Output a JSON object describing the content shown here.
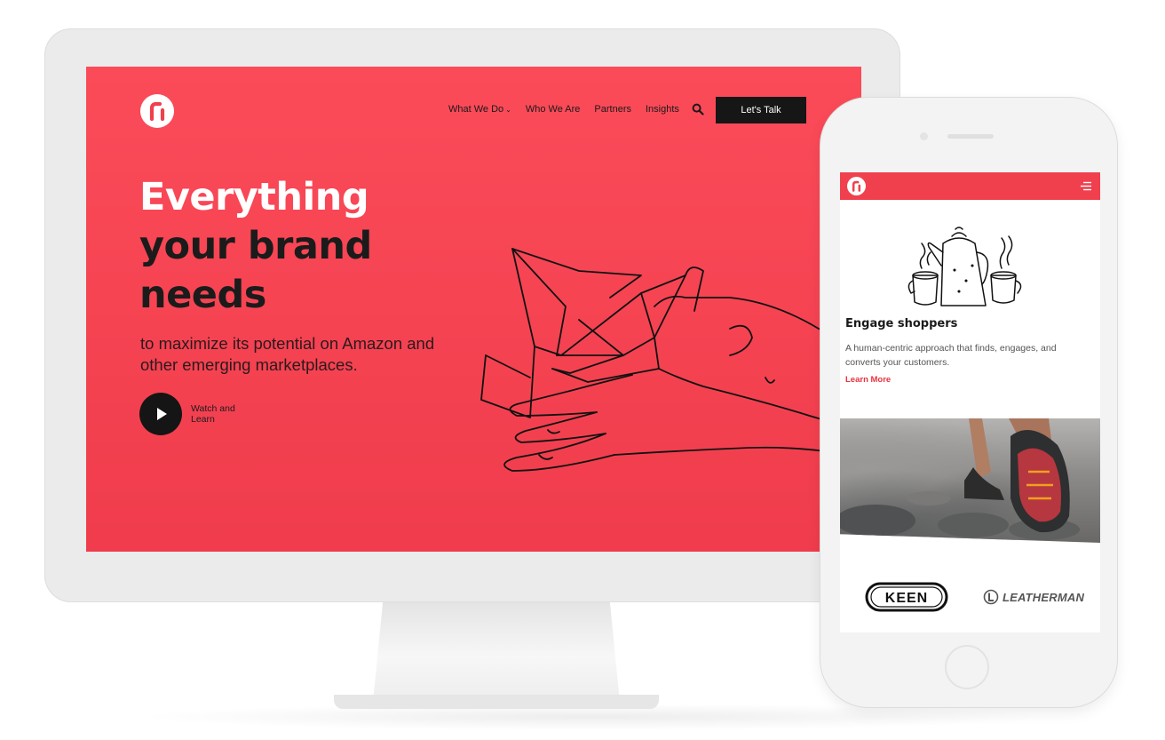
{
  "desktop": {
    "nav": {
      "items": [
        {
          "label": "What We Do",
          "has_dropdown": true
        },
        {
          "label": "Who We Are"
        },
        {
          "label": "Partners"
        },
        {
          "label": "Insights"
        }
      ],
      "search_icon": "search-icon",
      "cta_label": "Let's Talk"
    },
    "hero": {
      "title_line1": "Everything",
      "title_line2": "your brand",
      "title_line3": "needs",
      "subtitle": "to maximize its potential on Amazon and other emerging marketplaces.",
      "video_label": "Watch and Learn"
    }
  },
  "mobile": {
    "card": {
      "title": "Engage shoppers",
      "description": "A human-centric approach that finds, engages, and converts your customers.",
      "link_label": "Learn More"
    },
    "brands": [
      "KEEN",
      "LEATHERMAN"
    ]
  },
  "colors": {
    "brand_red": "#f0404e",
    "dark": "#161616",
    "link_red": "#e8323f"
  }
}
